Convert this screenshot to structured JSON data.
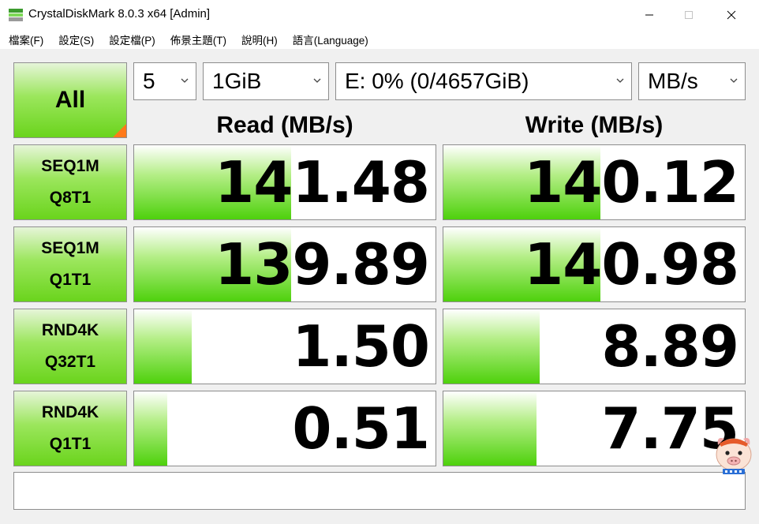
{
  "window": {
    "title": "CrystalDiskMark 8.0.3 x64 [Admin]"
  },
  "menu": {
    "items": [
      "檔案(F)",
      "設定(S)",
      "設定檔(P)",
      "佈景主題(T)",
      "說明(H)",
      "語言(Language)"
    ]
  },
  "controls": {
    "all_label": "All",
    "count_value": "5",
    "size_value": "1GiB",
    "drive_value": "E: 0% (0/4657GiB)",
    "unit_value": "MB/s"
  },
  "headers": {
    "read": "Read (MB/s)",
    "write": "Write (MB/s)"
  },
  "tests": [
    {
      "line1": "SEQ1M",
      "line2": "Q8T1",
      "read": "141.48",
      "write": "140.12",
      "read_fill": 0.52,
      "write_fill": 0.52
    },
    {
      "line1": "SEQ1M",
      "line2": "Q1T1",
      "read": "139.89",
      "write": "140.98",
      "read_fill": 0.52,
      "write_fill": 0.52
    },
    {
      "line1": "RND4K",
      "line2": "Q32T1",
      "read": "1.50",
      "write": "8.89",
      "read_fill": 0.19,
      "write_fill": 0.32
    },
    {
      "line1": "RND4K",
      "line2": "Q1T1",
      "read": "0.51",
      "write": "7.75",
      "read_fill": 0.11,
      "write_fill": 0.31
    }
  ],
  "comment": "",
  "colors": {
    "green_accent": "#4ed10c",
    "all_corner": "#ff7a1a"
  },
  "icons": {
    "app": "crystaldiskmark-icon",
    "minimize": "minimize-icon",
    "maximize": "maximize-icon",
    "close": "close-icon",
    "dropdown": "chevron-down-icon",
    "watermark": "mascot-icon"
  }
}
